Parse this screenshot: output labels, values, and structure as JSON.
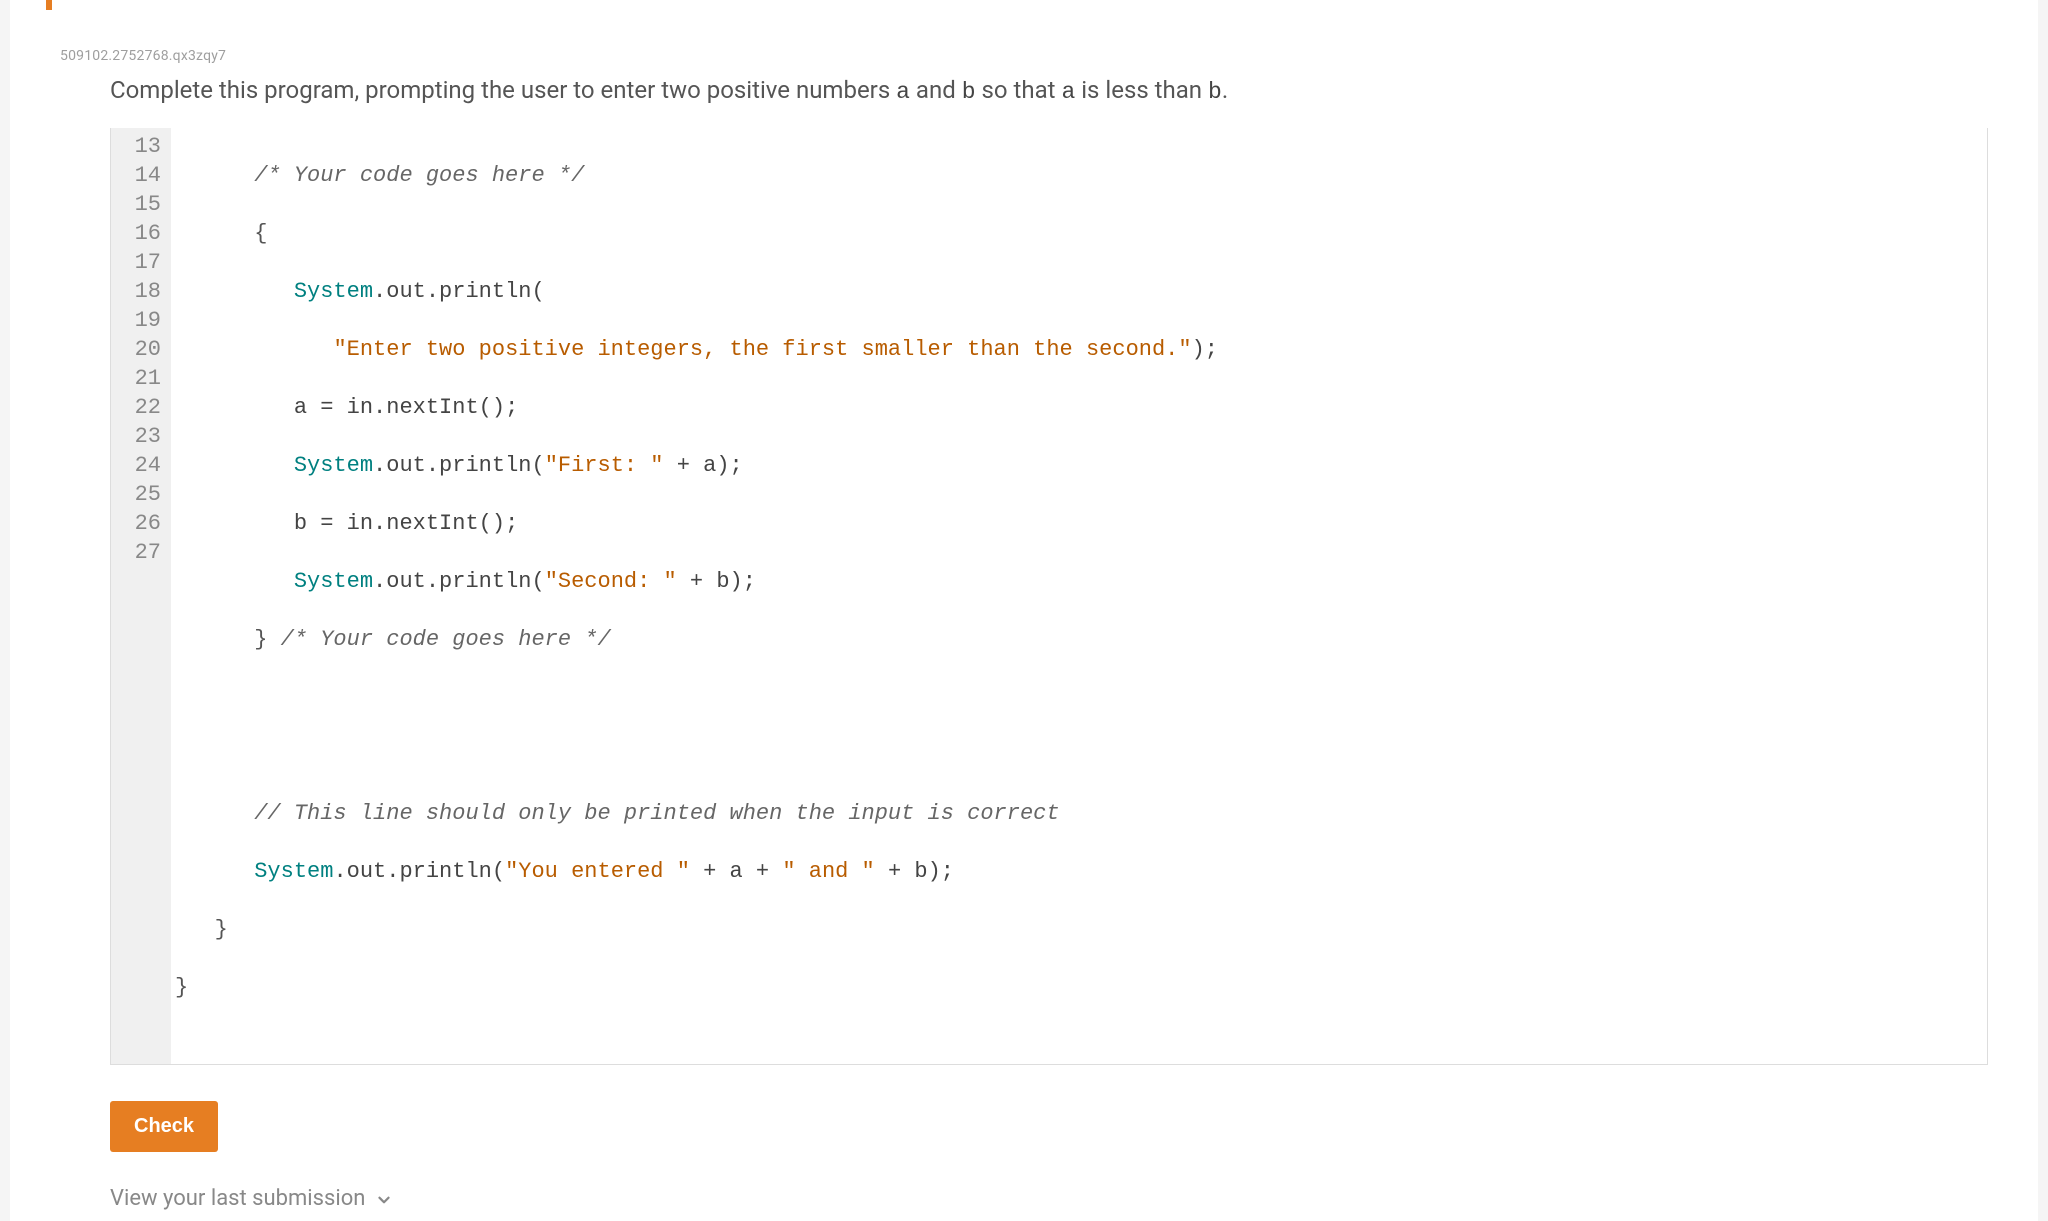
{
  "problem_id": "509102.2752768.qx3zqy7",
  "instruction": {
    "prefix": "Complete this program, prompting the user to enter two positive numbers ",
    "a": "a",
    "mid1": " and ",
    "b": "b",
    "mid2": " so that ",
    "a2": "a",
    "mid3": " is less than ",
    "b2": "b",
    "suffix": "."
  },
  "lines": {
    "start": 13,
    "end": 27
  },
  "code": {
    "l13_comment": "/* Your code goes here */",
    "l14_brace": "{",
    "l15_sys": "System",
    "l15_out": ".out.println(",
    "l16_str": "\"Enter two positive integers, the first smaller than the second.\"",
    "l16_end": ");",
    "l17_a": "a = in.nextInt();",
    "l18_sys": "System",
    "l18_mid": ".out.println(",
    "l18_str": "\"First: \"",
    "l18_end": " + a);",
    "l19_b": "b = in.nextInt();",
    "l20_sys": "System",
    "l20_mid": ".out.println(",
    "l20_str": "\"Second: \"",
    "l20_end": " + b);",
    "l21_brace": "}",
    "l21_comment": " /* Your code goes here */",
    "l24_comment": "// This line should only be printed when the input is correct",
    "l25_sys": "System",
    "l25_mid": ".out.println(",
    "l25_str1": "\"You entered \"",
    "l25_plus1": " + a + ",
    "l25_str2": "\" and \"",
    "l25_end": " + b);",
    "l26_brace": "}",
    "l27_brace": "}"
  },
  "check_label": "Check",
  "view_last": "View your last submission"
}
